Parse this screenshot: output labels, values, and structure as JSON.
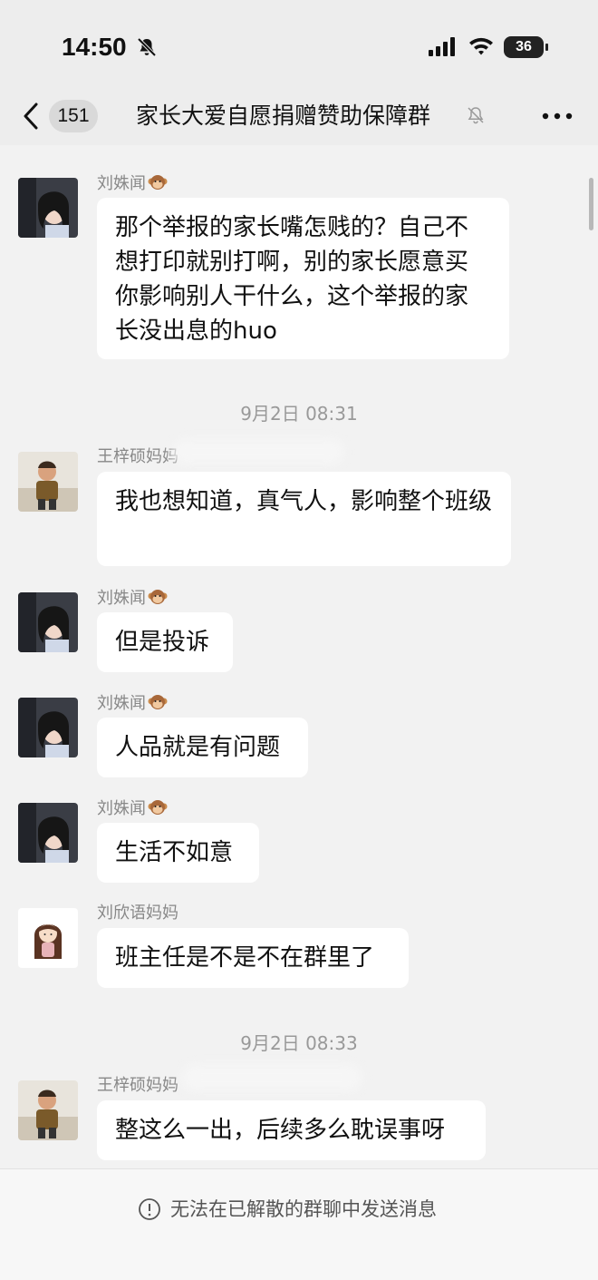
{
  "status_bar": {
    "time": "14:50",
    "battery": "36"
  },
  "nav": {
    "unread_count": "151",
    "title": "家长大爱自愿捐赠赞助保障群"
  },
  "messages": [
    {
      "sender": "刘姝闻",
      "text": "那个举报的家长嘴怎贱的？自己不想打印就别打啊，别的家长愿意买你影响别人干什么，这个举报的家长没出息的huo"
    },
    {
      "sender": "王梓硕妈妈",
      "text": "我也想知道，真气人，影响整个班级"
    },
    {
      "sender": "刘姝闻",
      "text": "但是投诉"
    },
    {
      "sender": "刘姝闻",
      "text": "人品就是有问题"
    },
    {
      "sender": "刘姝闻",
      "text": "生活不如意"
    },
    {
      "sender": "刘欣语妈妈",
      "text": "班主任是不是不在群里了"
    },
    {
      "sender": "王梓硕妈妈",
      "text": "整这么一出，后续多么耽误事呀"
    }
  ],
  "timestamps": [
    "9月2日 08:31",
    "9月2日 08:33"
  ],
  "footer": {
    "notice": "无法在已解散的群聊中发送消息"
  },
  "icons": [
    "mute-icon",
    "signal-icon",
    "wifi-icon",
    "back-icon",
    "bell-off-icon",
    "more-icon",
    "monkey-emoji-icon",
    "info-icon"
  ],
  "colors": {
    "background": "#ededed",
    "chat_background": "#f2f2f2",
    "bubble": "#ffffff",
    "meta_text": "#999999"
  }
}
